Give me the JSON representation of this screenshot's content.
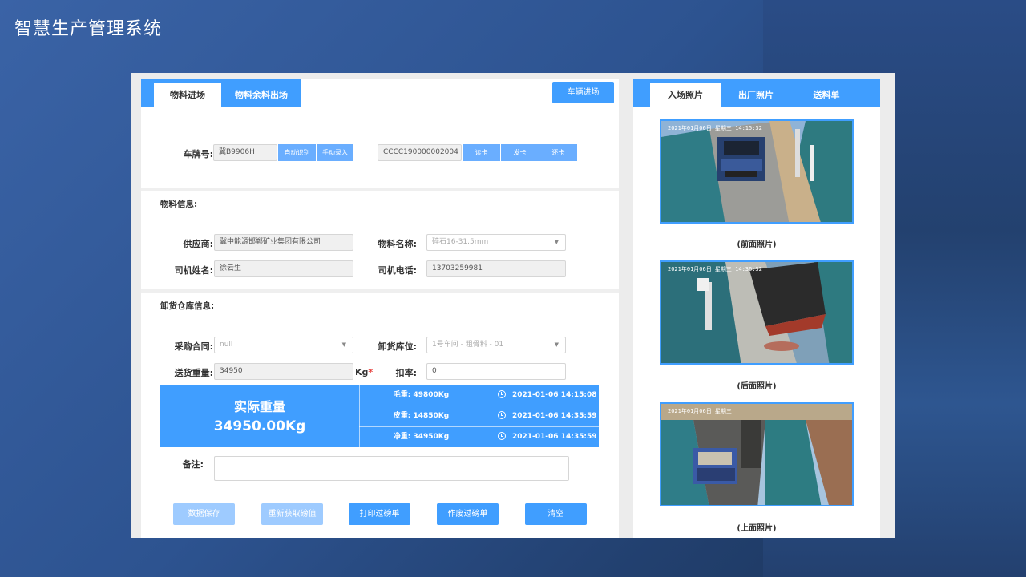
{
  "app": {
    "title": "智慧生产管理系统"
  },
  "tabs": [
    {
      "label": "物料进场",
      "active": true
    },
    {
      "label": "物料余料出场",
      "active": false
    }
  ],
  "vehicle_entry_button": "车辆进场",
  "plate": {
    "label": "车牌号:",
    "value": "冀B9906H",
    "auto_button": "自动识别",
    "manual_button": "手动录入",
    "card_value": "CCCC190000002004",
    "read_card_button": "读卡",
    "issue_card_button": "发卡",
    "return_card_button": "还卡"
  },
  "material_info": {
    "section": "物料信息:",
    "supplier_label": "供应商:",
    "supplier_value": "冀中能源邯郸矿业集团有限公司",
    "material_label": "物料名称:",
    "material_value": "碎石16-31.5mm",
    "driver_name_label": "司机姓名:",
    "driver_name_value": "徐云生",
    "driver_phone_label": "司机电话:",
    "driver_phone_value": "13703259981"
  },
  "warehouse_info": {
    "section": "卸货仓库信息:",
    "contract_label": "采购合同:",
    "contract_value": "null",
    "location_label": "卸货库位:",
    "location_value": "1号车间 - 粗骨料 - 01",
    "weight_label": "送货重量:",
    "weight_value": "34950",
    "weight_unit": "Kg",
    "required_mark": "*",
    "deduction_label": "扣率:",
    "deduction_value": "0"
  },
  "weight_summary": {
    "title": "实际重量",
    "value": "34950.00Kg",
    "rows": [
      {
        "label": "毛重: 49800Kg",
        "time": "2021-01-06 14:15:08"
      },
      {
        "label": "皮重: 14850Kg",
        "time": "2021-01-06 14:35:59"
      },
      {
        "label": "净重: 34950Kg",
        "time": "2021-01-06 14:35:59"
      }
    ]
  },
  "remark": {
    "label": "备注:",
    "value": ""
  },
  "actions": [
    {
      "label": "数据保存",
      "enabled": false
    },
    {
      "label": "重新获取磅值",
      "enabled": false
    },
    {
      "label": "打印过磅单",
      "enabled": true
    },
    {
      "label": "作废过磅单",
      "enabled": true
    },
    {
      "label": "清空",
      "enabled": true
    }
  ],
  "photo_tabs": [
    {
      "label": "入场照片",
      "active": true
    },
    {
      "label": "出厂照片",
      "active": false
    },
    {
      "label": "送料单",
      "active": false
    }
  ],
  "photos": [
    {
      "caption": "(前面照片)",
      "stamp": "2021年01月06日 星期三 14:15:32"
    },
    {
      "caption": "(后面照片)",
      "stamp": "2021年01月06日 星期三 14:36:32"
    },
    {
      "caption": "(上面照片)",
      "stamp": "2021年01月06日 星期三"
    }
  ],
  "colors": {
    "accent": "#409eff",
    "accent_disabled": "#9ecbff",
    "required": "#e53935"
  }
}
